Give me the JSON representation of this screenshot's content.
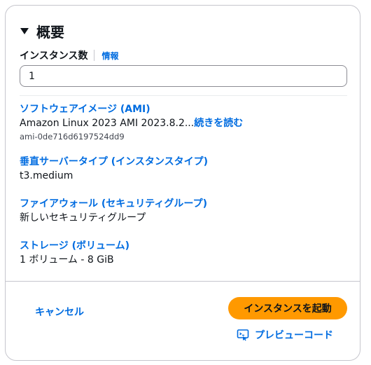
{
  "summary": {
    "title": "概要"
  },
  "instance_count": {
    "label": "インスタンス数",
    "info_link": "情報",
    "value": "1"
  },
  "sections": {
    "ami": {
      "title": "ソフトウェアイメージ (AMI)",
      "value": "Amazon Linux 2023 AMI 2023.8.2...",
      "read_more": "続きを読む",
      "id": "ami-0de716d6197524dd9"
    },
    "instance_type": {
      "title": "垂直サーバータイプ (インスタンスタイプ)",
      "value": "t3.medium"
    },
    "firewall": {
      "title": "ファイアウォール (セキュリティグループ)",
      "value": "新しいセキュリティグループ"
    },
    "storage": {
      "title": "ストレージ (ボリューム)",
      "value": "1 ボリューム - 8 GiB"
    }
  },
  "footer": {
    "cancel_label": "キャンセル",
    "launch_label": "インスタンスを起動",
    "preview_label": "プレビューコード"
  },
  "colors": {
    "link": "#006ce0",
    "primary_button": "#ff9900",
    "text": "#0f141a"
  }
}
